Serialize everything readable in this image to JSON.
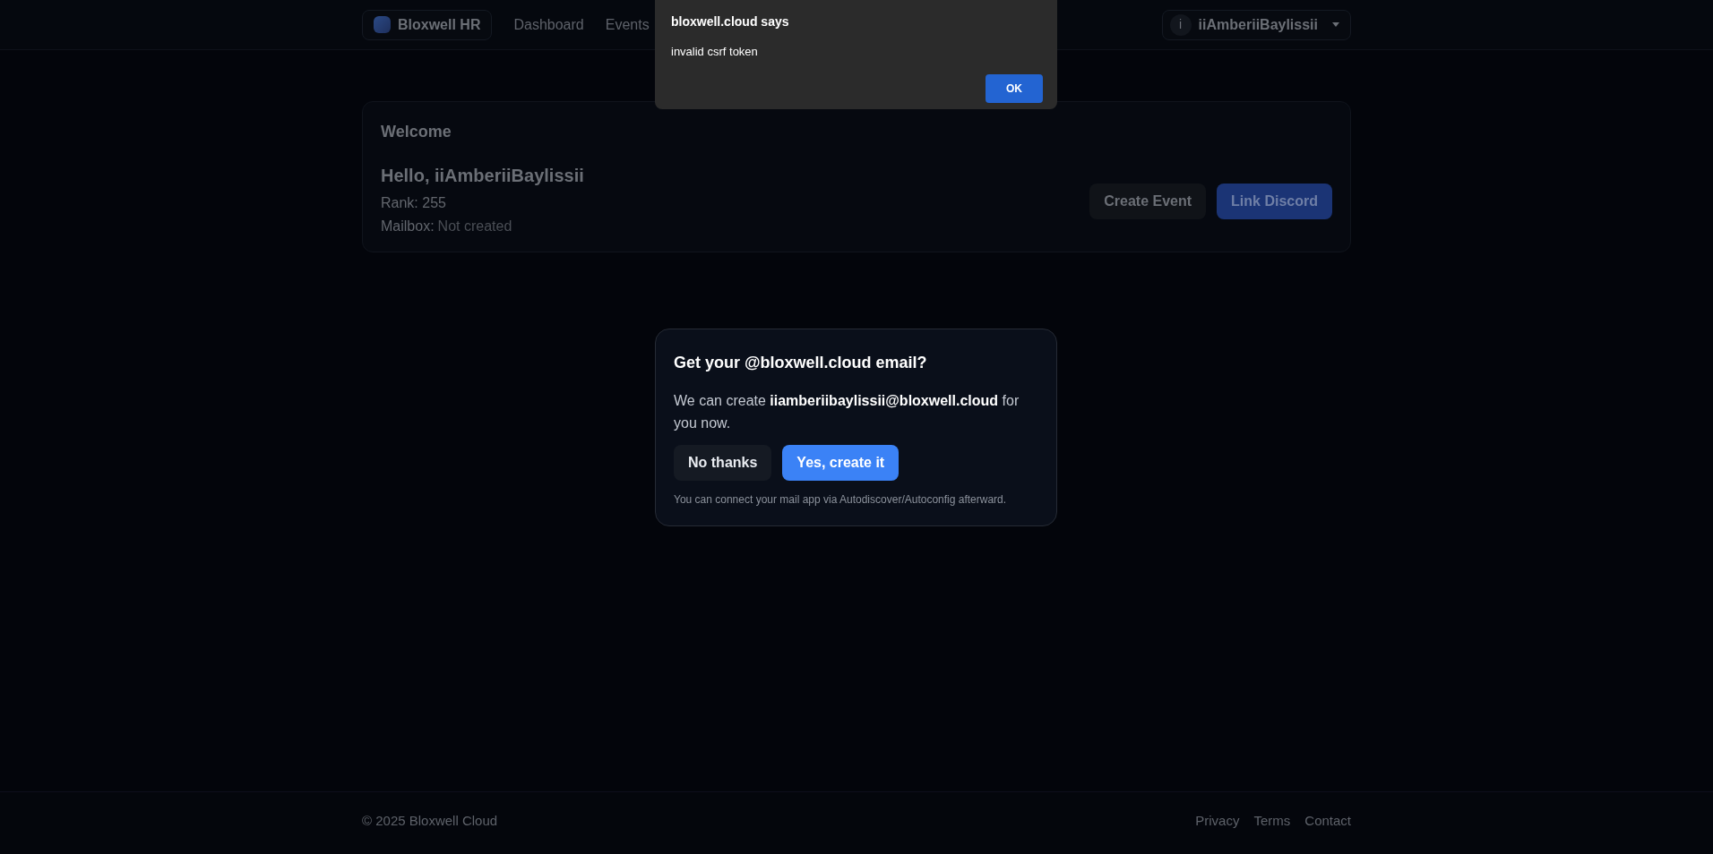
{
  "nav": {
    "brand": "Bloxwell HR",
    "links": [
      "Dashboard",
      "Events"
    ],
    "user": {
      "initial": "i",
      "name": "iiAmberiiBaylissii"
    }
  },
  "alert": {
    "title": "bloxwell.cloud says",
    "message": "invalid csrf token",
    "button": "OK"
  },
  "welcome": {
    "title": "Welcome",
    "greeting": "Hello, iiAmberiiBaylissii",
    "rank": "Rank: 255",
    "mailbox_label": "Mailbox:",
    "mailbox_value": "Not created",
    "buttons": [
      {
        "label": "Create Event",
        "kind": "secondary"
      },
      {
        "label": "Link Discord",
        "kind": "primary"
      }
    ]
  },
  "modal": {
    "title": "Get your @bloxwell.cloud email?",
    "body": "We can create **iiamberiibaylissii@bloxwell.cloud** for you now.",
    "buttons": [
      {
        "label": "No thanks",
        "kind": "secondary"
      },
      {
        "label": "Yes, create it",
        "kind": "primary"
      }
    ],
    "note": "You can connect your mail app via Autodiscover/Autoconfig afterward."
  },
  "footer": {
    "copyright": "© 2025 Bloxwell Cloud",
    "links": [
      "Privacy",
      "Terms",
      "Contact"
    ]
  }
}
